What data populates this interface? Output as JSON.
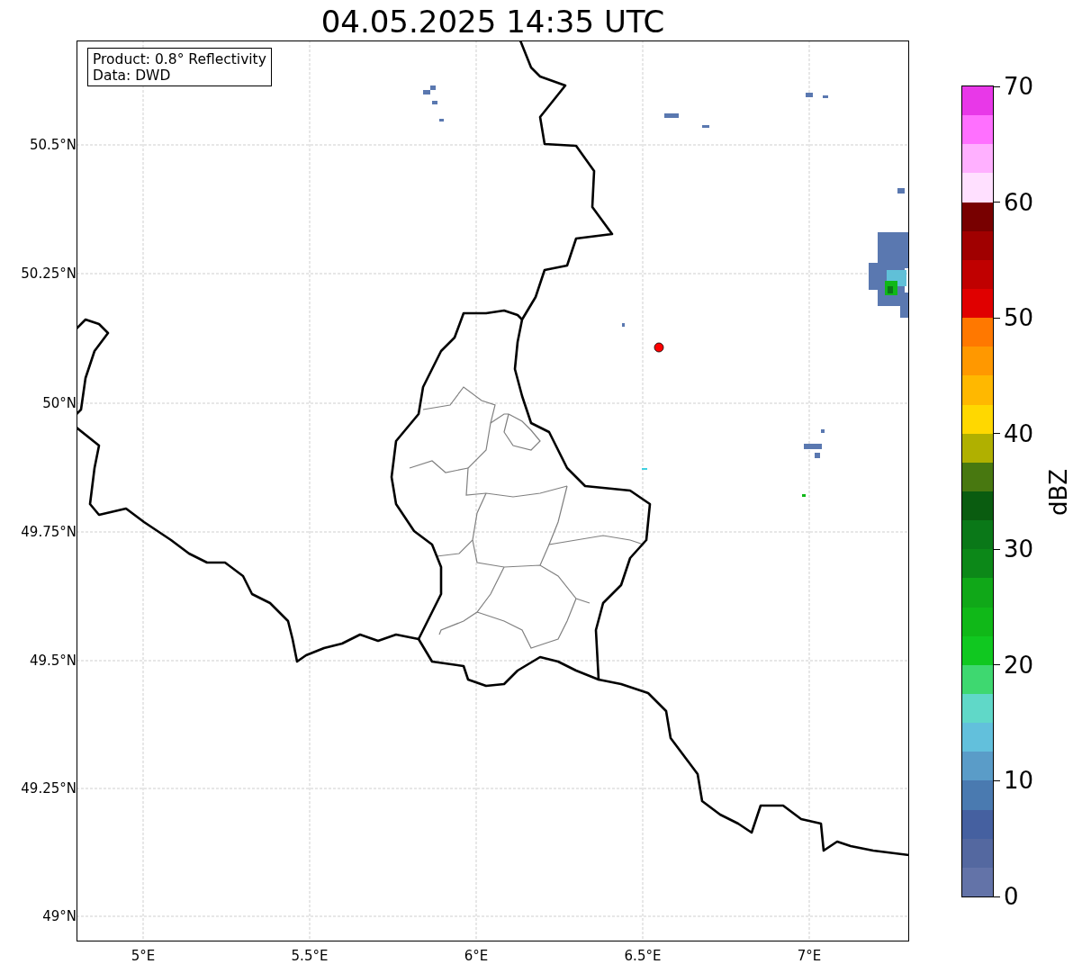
{
  "title": "04.05.2025 14:35 UTC",
  "map": {
    "annotation": [
      "Product: 0.8° Reflectivity",
      "Data: DWD"
    ],
    "xticks": [
      "5°E",
      "5.5°E",
      "6°E",
      "6.5°E",
      "7°E"
    ],
    "yticks": [
      "50.5°N",
      "50.25°N",
      "50°N",
      "49.75°N",
      "49.5°N",
      "49.25°N",
      "49°N"
    ]
  },
  "colorbar": {
    "label": "dBZ",
    "ticks": [
      "70",
      "60",
      "50",
      "40",
      "30",
      "20",
      "10",
      "0"
    ],
    "segments": [
      {
        "color": "#e838e8"
      },
      {
        "color": "#ff70ff"
      },
      {
        "color": "#ffb0ff"
      },
      {
        "color": "#ffe0ff"
      },
      {
        "color": "#780000"
      },
      {
        "color": "#a00000"
      },
      {
        "color": "#c00000"
      },
      {
        "color": "#e00000"
      },
      {
        "color": "#ff7800"
      },
      {
        "color": "#ff9800"
      },
      {
        "color": "#ffb800"
      },
      {
        "color": "#ffd800"
      },
      {
        "color": "#b0b000"
      },
      {
        "color": "#487810"
      },
      {
        "color": "#0a5c10"
      },
      {
        "color": "#0a7818"
      },
      {
        "color": "#0c8818"
      },
      {
        "color": "#10a818"
      },
      {
        "color": "#10b818"
      },
      {
        "color": "#10c820"
      },
      {
        "color": "#3ed870"
      },
      {
        "color": "#60d8c8"
      },
      {
        "color": "#62c0dc"
      },
      {
        "color": "#5a9cc8"
      },
      {
        "color": "#4a7ab0"
      },
      {
        "color": "#4560a0"
      },
      {
        "color": "#5468a0"
      },
      {
        "color": "#6373a8"
      }
    ]
  }
}
